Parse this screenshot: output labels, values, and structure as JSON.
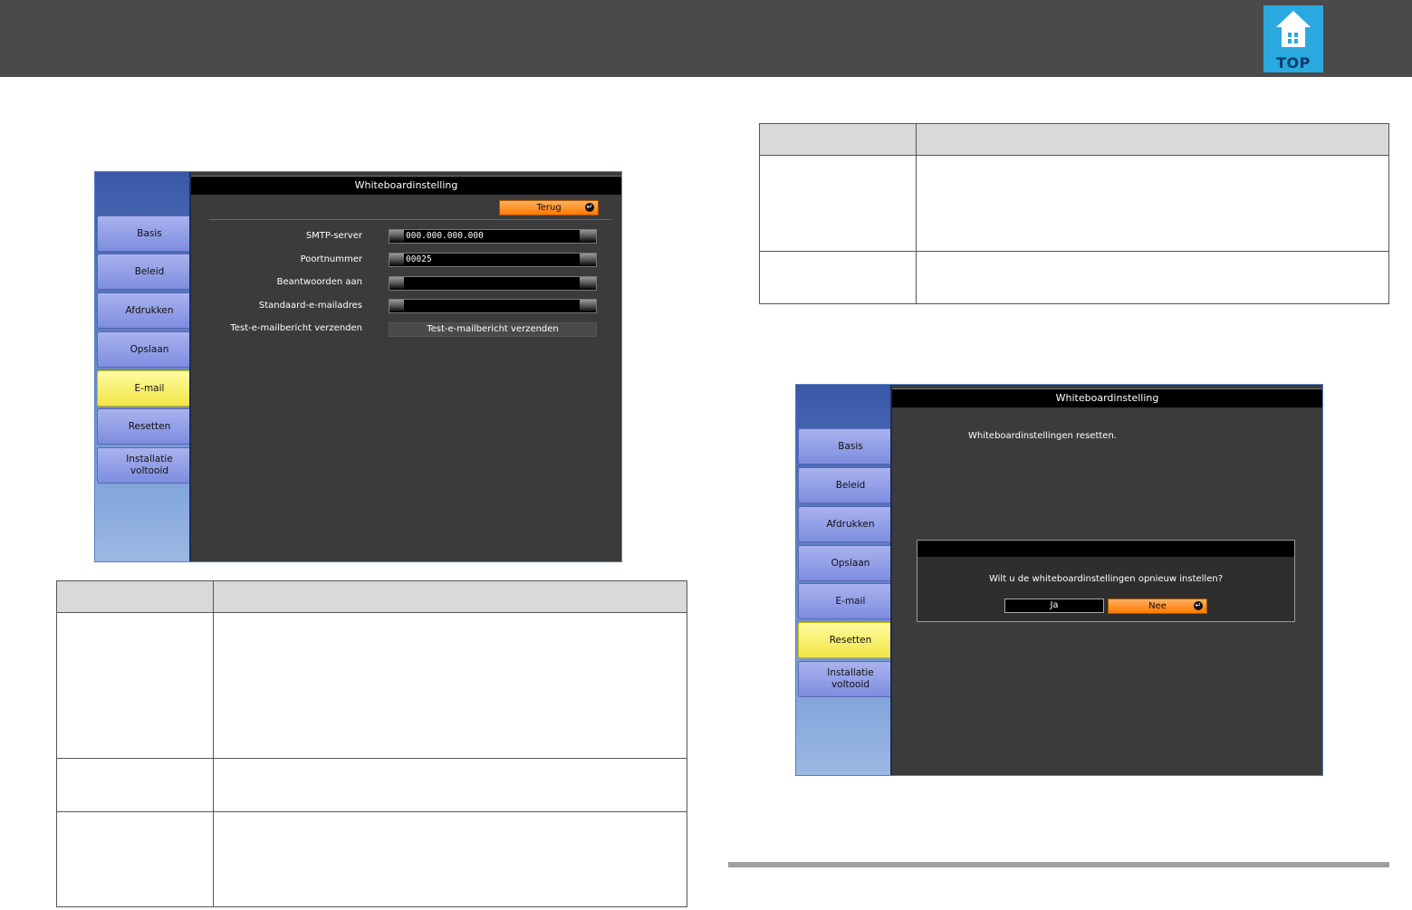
{
  "top_button": {
    "label": "TOP",
    "icon": "home-icon"
  },
  "nav": {
    "basis": "Basis",
    "beleid": "Beleid",
    "afdrukken": "Afdrukken",
    "opslaan": "Opslaan",
    "email": "E-mail",
    "resetten": "Resetten",
    "installatie_line1": "Installatie",
    "installatie_line2": "voltooid"
  },
  "email_screen": {
    "title": "Whiteboardinstelling",
    "back_label": "Terug",
    "fields": {
      "smtp_label": "SMTP-server",
      "smtp_value": "000.000.000.000",
      "port_label": "Poortnummer",
      "port_value": "00025",
      "reply_label": "Beantwoorden aan",
      "reply_value": "",
      "default_label": "Standaard-e-mailadres",
      "default_value": "",
      "test_label": "Test-e-mailbericht verzenden",
      "test_button": "Test-e-mailbericht verzenden"
    }
  },
  "reset_screen": {
    "title": "Whiteboardinstelling",
    "message": "Whiteboardinstellingen resetten.",
    "dialog_question": "Wilt u de whiteboardinstellingen opnieuw instellen?",
    "yes_label": "Ja",
    "no_label": "Nee"
  },
  "colors": {
    "header_bar": "#4a4a4a",
    "active_nav": "#f5e84a",
    "nav_button": "#8f9ce6",
    "accent_orange": "#ff7a00",
    "top_icon": "#2aa9e0"
  }
}
